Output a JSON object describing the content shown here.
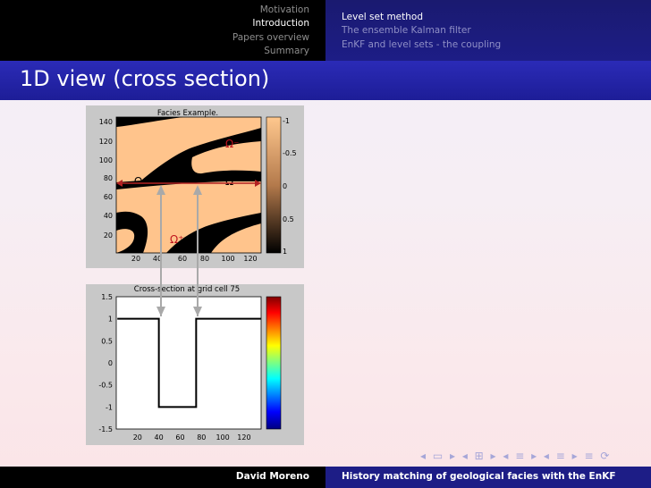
{
  "header": {
    "sections": [
      {
        "label": "Motivation",
        "active": false
      },
      {
        "label": "Introduction",
        "active": true
      },
      {
        "label": "Papers overview",
        "active": false
      },
      {
        "label": "Summary",
        "active": false
      }
    ],
    "subsections": [
      {
        "label": "Level set method",
        "active": true
      },
      {
        "label": "The ensemble Kalman filter",
        "active": false
      },
      {
        "label": "EnKF and level sets - the coupling",
        "active": false
      }
    ]
  },
  "frame": {
    "title": "1D view (cross section)"
  },
  "figure_top": {
    "title": "Facies Example.",
    "y_ticks": [
      "140",
      "120",
      "100",
      "80",
      "60",
      "40",
      "20"
    ],
    "x_ticks": [
      "20",
      "40",
      "60",
      "80",
      "100",
      "120"
    ],
    "colorbar_ticks": [
      "-1",
      "-0.5",
      "0",
      "0.5",
      "1"
    ],
    "labels": {
      "omega_minus": "Ω⁻",
      "omega_plus_left": "Ω⁺",
      "omega_plus_right": "Ω⁺",
      "omega_plus_bottom": "Ω⁺"
    },
    "colors": {
      "facies_sand": "#ffc48c",
      "facies_shale": "#000000",
      "section_line": "#b22222"
    }
  },
  "chart_data": {
    "type": "line",
    "title": "Cross-section at grid cell 75",
    "x": [
      1,
      40,
      40,
      75,
      75,
      136
    ],
    "y": [
      1,
      1,
      -1,
      -1,
      1,
      1
    ],
    "xlim": [
      0,
      136
    ],
    "ylim": [
      -1.5,
      1.5
    ],
    "x_ticks": [
      "20",
      "40",
      "60",
      "80",
      "100",
      "120"
    ],
    "y_ticks": [
      "1.5",
      "1",
      "0.5",
      "0",
      "-0.5",
      "-1",
      "-1.5"
    ],
    "colorbar": "jet"
  },
  "footer": {
    "author": "David Moreno",
    "title": "History matching of geological facies with the EnKF"
  },
  "nav_symbols": "◂ ▭ ▸ ◂ ⊞ ▸ ◂ ≡ ▸ ◂ ≡ ▸ ≡ ⟳"
}
